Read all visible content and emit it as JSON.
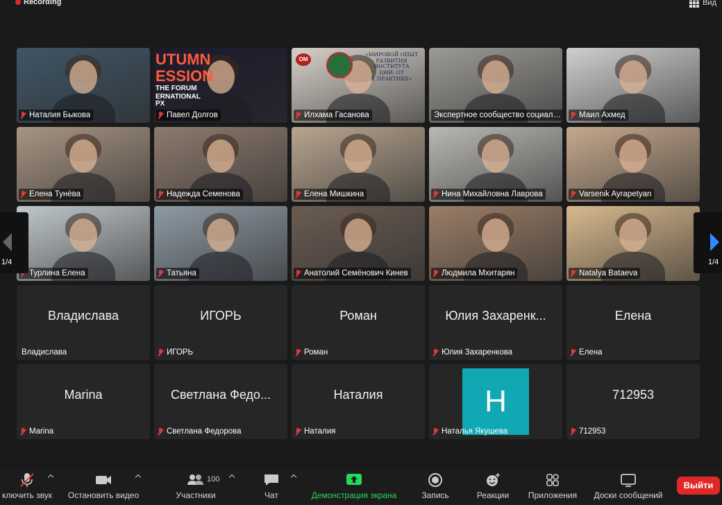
{
  "recording_label": "Recording",
  "view_label": "Вид",
  "page_left": "1/4",
  "page_right": "1/4",
  "participants": [
    {
      "name": "Наталия Быкова",
      "bg": "#3f5566",
      "muted": true
    },
    {
      "name": "Павел Долгов",
      "bg": "#1c1a2c",
      "muted": true,
      "banner": [
        "UTUMN",
        "ESSION",
        "THE FORUM",
        "ERNATIONAL PX"
      ]
    },
    {
      "name": "Илхама Гасанова",
      "bg": "#d6d0c8",
      "muted": true,
      "active": true,
      "slide": [
        "«МИРОВОЙ ОПЫТ",
        "РАЗВИТИЯ ИНСТИТУТА",
        "ЦИИ: ОТ",
        "К ПРАКТИКЕ»"
      ],
      "logo": "OM"
    },
    {
      "name": "Экспертное сообщество социальной ответственности",
      "bg": "#9c9a96",
      "muted": false
    },
    {
      "name": "Маил Ахмед",
      "bg": "#cfcfcf",
      "muted": true
    },
    {
      "name": "Елена Тунёва",
      "bg": "#a79583",
      "muted": true
    },
    {
      "name": "Надежда Семенова",
      "bg": "#8d7a6e",
      "muted": true
    },
    {
      "name": "Елена Мишкина",
      "bg": "#b8a590",
      "muted": true
    },
    {
      "name": "Нина Михайловна Лаврова",
      "bg": "#b9b8b4",
      "muted": true
    },
    {
      "name": "Varsenik Ayrapetyan",
      "bg": "#c6a98e",
      "muted": true
    },
    {
      "name": "Турлина Елена",
      "bg": "#c0c8cc",
      "muted": true
    },
    {
      "name": "Татьяна",
      "bg": "#8e9aa4",
      "muted": true
    },
    {
      "name": "Анатолий Семёнович Кинев",
      "bg": "#6a5c52",
      "muted": true
    },
    {
      "name": "Людмила Мхитарян",
      "bg": "#9a7e68",
      "muted": true
    },
    {
      "name": "Natalya Bataeva",
      "bg": "#d8b98e",
      "muted": true
    },
    {
      "name": "Владислава",
      "muted": false,
      "noimg": true,
      "big": "Владислава"
    },
    {
      "name": "ИГОРЬ",
      "muted": true,
      "noimg": true,
      "big": "ИГОРЬ"
    },
    {
      "name": "Роман",
      "muted": true,
      "noimg": true,
      "big": "Роман"
    },
    {
      "name": "Юлия Захаренкова",
      "muted": true,
      "noimg": true,
      "big": "Юлия Захаренк..."
    },
    {
      "name": "Елена",
      "muted": true,
      "noimg": true,
      "big": "Елена"
    },
    {
      "name": "Marina",
      "muted": true,
      "noimg": true,
      "big": "Marina"
    },
    {
      "name": "Светлана Федорова",
      "muted": true,
      "noimg": true,
      "big": "Светлана Федо..."
    },
    {
      "name": "Наталия",
      "muted": true,
      "noimg": true,
      "big": "Наталия"
    },
    {
      "name": "Наталья Якушева",
      "muted": true,
      "noimg": true,
      "avatar_letter": "H"
    },
    {
      "name": "712953",
      "muted": true,
      "noimg": true,
      "big": "712953"
    }
  ],
  "toolbar": {
    "mute_label": "ключить звук",
    "video_label": "Остановить видео",
    "participants_label": "Участники",
    "participants_count": "100",
    "chat_label": "Чат",
    "share_label": "Демонстрация экрана",
    "record_label": "Запись",
    "reactions_label": "Реакции",
    "apps_label": "Приложения",
    "whiteboards_label": "Доски сообщений",
    "leave_label": "Выйти"
  },
  "colors": {
    "accent_green": "#23d95b",
    "accent_blue": "#2d8cff",
    "leave_red": "#e02828",
    "avatar_teal": "#10a8b3",
    "mute_red": "#e0393e"
  }
}
